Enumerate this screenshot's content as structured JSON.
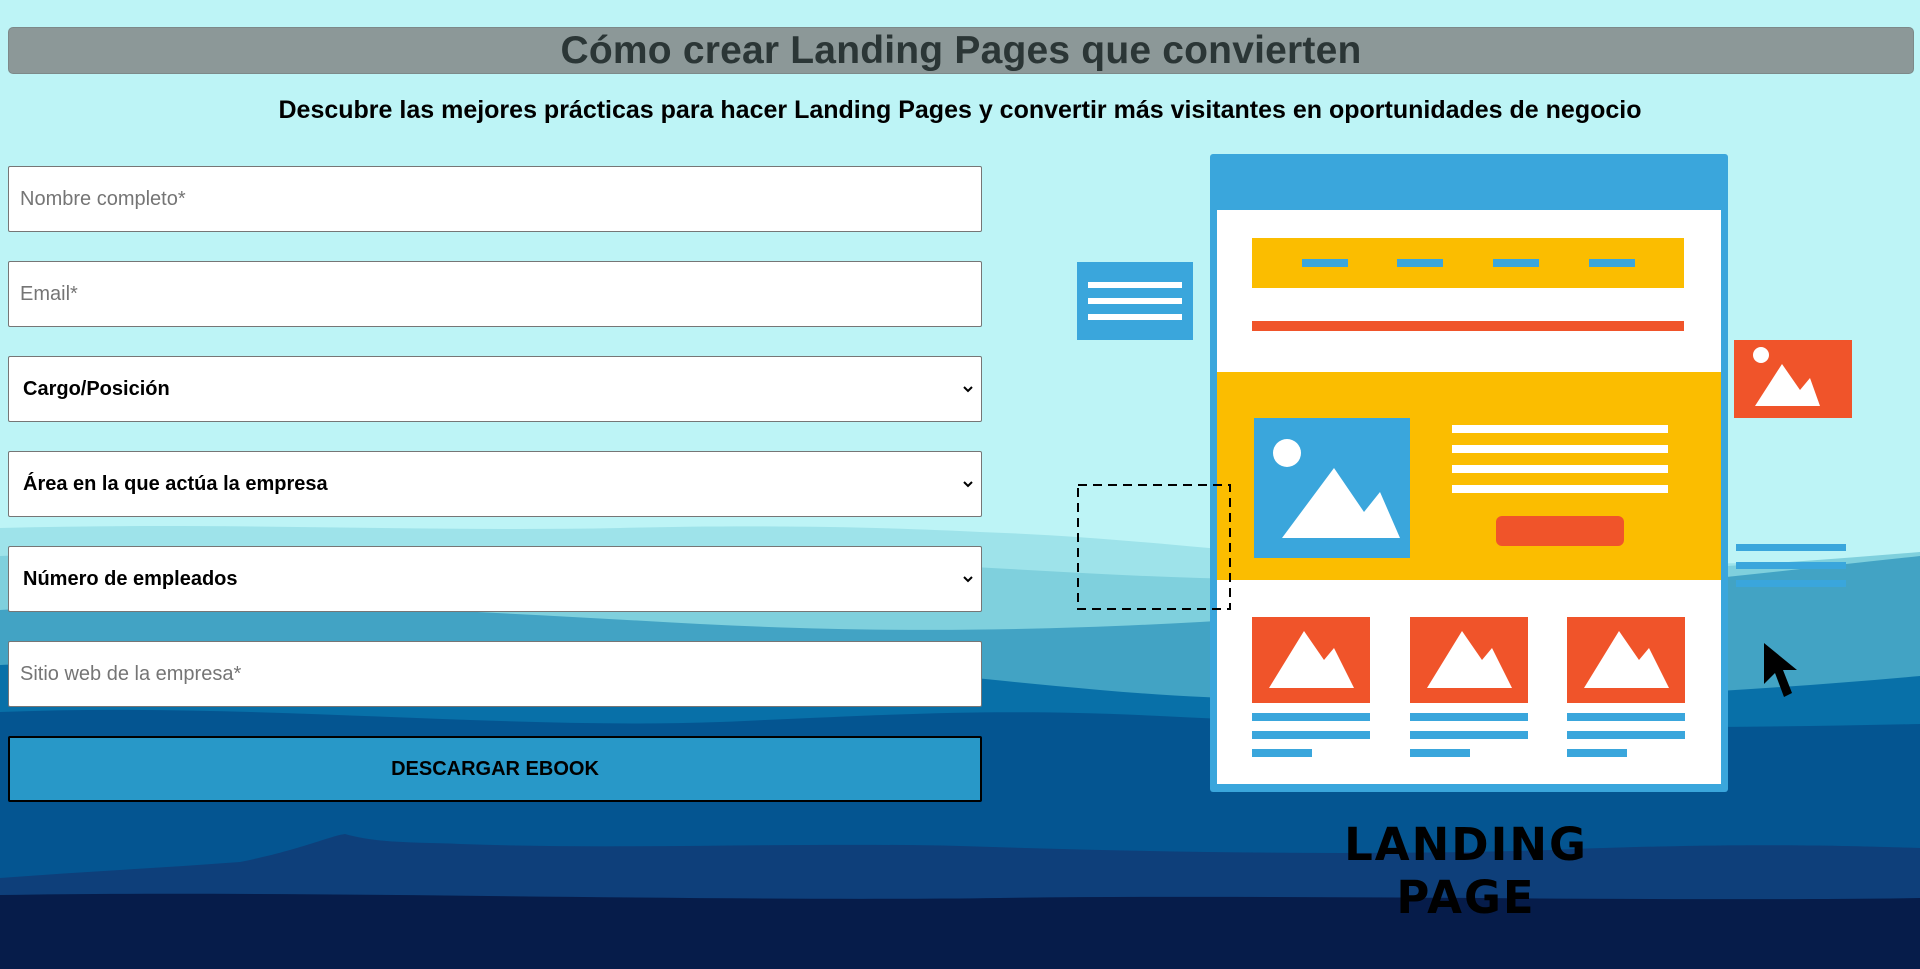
{
  "header": {
    "title": "Cómo crear Landing Pages que convierten",
    "subtitle": "Descubre las mejores prácticas para hacer Landing Pages y convertir más visitantes en oportunidades de negocio"
  },
  "form": {
    "name_placeholder": "Nombre completo*",
    "email_placeholder": "Email*",
    "role_select": "Cargo/Posición",
    "industry_select": "Área en la que actúa la empresa",
    "employees_select": "Número de empleados",
    "website_placeholder": "Sitio web de la empresa*",
    "submit_label": "DESCARGAR EBOOK"
  },
  "illustration": {
    "caption": "LANDING PAGE"
  },
  "colors": {
    "sky": "#bdf4f6",
    "button": "#2898c8",
    "illustration_blue": "#3aa6dc",
    "illustration_yellow": "#fbbd00",
    "illustration_orange": "#f0542a"
  }
}
